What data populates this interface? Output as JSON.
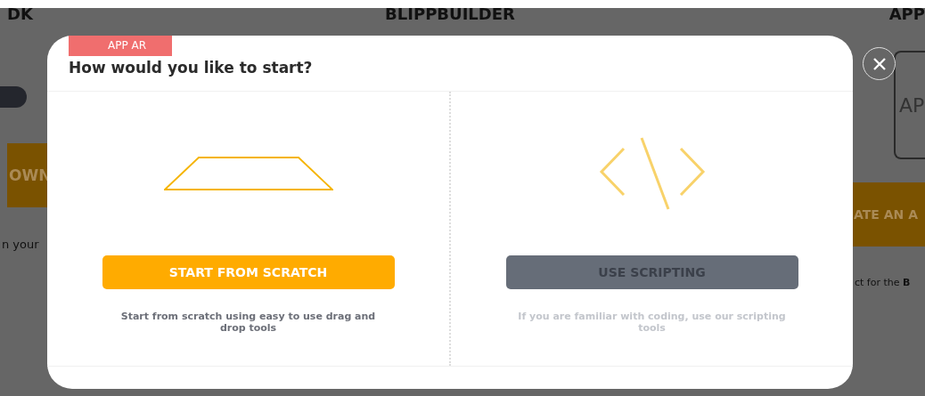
{
  "background_page": {
    "header": [
      "DK",
      "BLIPPBUILDER",
      "APP"
    ],
    "left_button": "OWN",
    "right_button": "ATE AN A",
    "left_text": "n your",
    "right_text": "ct for the **B**",
    "card_text": "AP"
  },
  "dialog": {
    "tag": "APP AR",
    "title": "How would you like to start?",
    "options": [
      {
        "kind": "scratch",
        "button": "START FROM SCRATCH",
        "description": "Start from scratch using easy to use drag and drop tools",
        "disabled": false
      },
      {
        "kind": "scripting",
        "button": "USE SCRIPTING",
        "description": "If you are familiar with coding, use our scripting tools",
        "disabled": true
      }
    ]
  }
}
